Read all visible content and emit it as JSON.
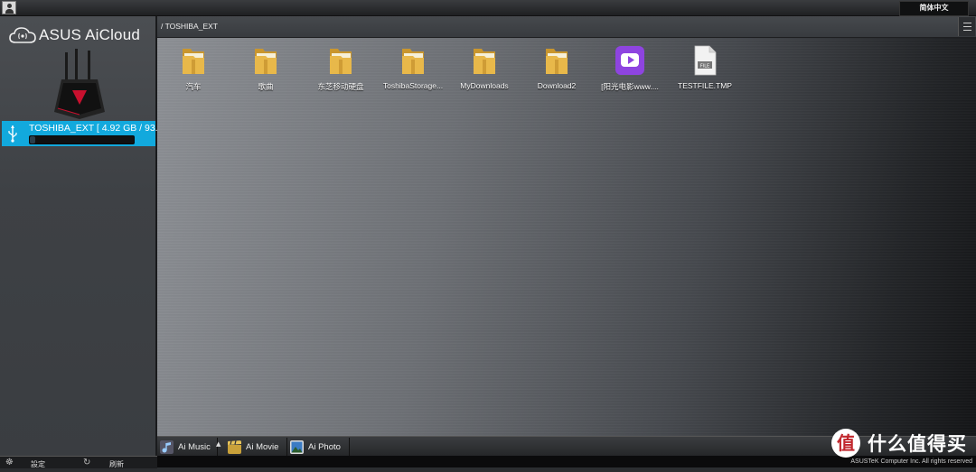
{
  "topbar": {
    "language": "简体中文"
  },
  "sidebar": {
    "brand": "ASUS AiCloud",
    "device": {
      "label": "TOSHIBA_EXT [ 4.92 GB / 93...",
      "usage_fraction": 0.05
    },
    "footer": {
      "settings_label": "設定",
      "refresh_label": "刷新"
    }
  },
  "path": "/ TOSHIBA_EXT",
  "files": [
    {
      "name": "汽车",
      "type": "folder"
    },
    {
      "name": "歌曲",
      "type": "folder"
    },
    {
      "name": "东芝移动硬盘",
      "type": "folder"
    },
    {
      "name": "ToshibaStorage...",
      "type": "folder"
    },
    {
      "name": "MyDownloads",
      "type": "folder"
    },
    {
      "name": "Download2",
      "type": "folder"
    },
    {
      "name": "[阳光电影www....",
      "type": "video"
    },
    {
      "name": "TESTFILE.TMP",
      "type": "file",
      "badge": "FILE"
    }
  ],
  "dock": {
    "music": "Ai Music",
    "movie": "Ai Movie",
    "photo": "Ai Photo"
  },
  "status": {
    "copyright": "ASUSTeK Computer Inc. All rights reserved"
  },
  "watermark": {
    "badge": "值",
    "text": "什么值得买"
  },
  "colors": {
    "accent": "#12a9dd",
    "folder": "#e8b84a",
    "video": "#8e44e0"
  }
}
